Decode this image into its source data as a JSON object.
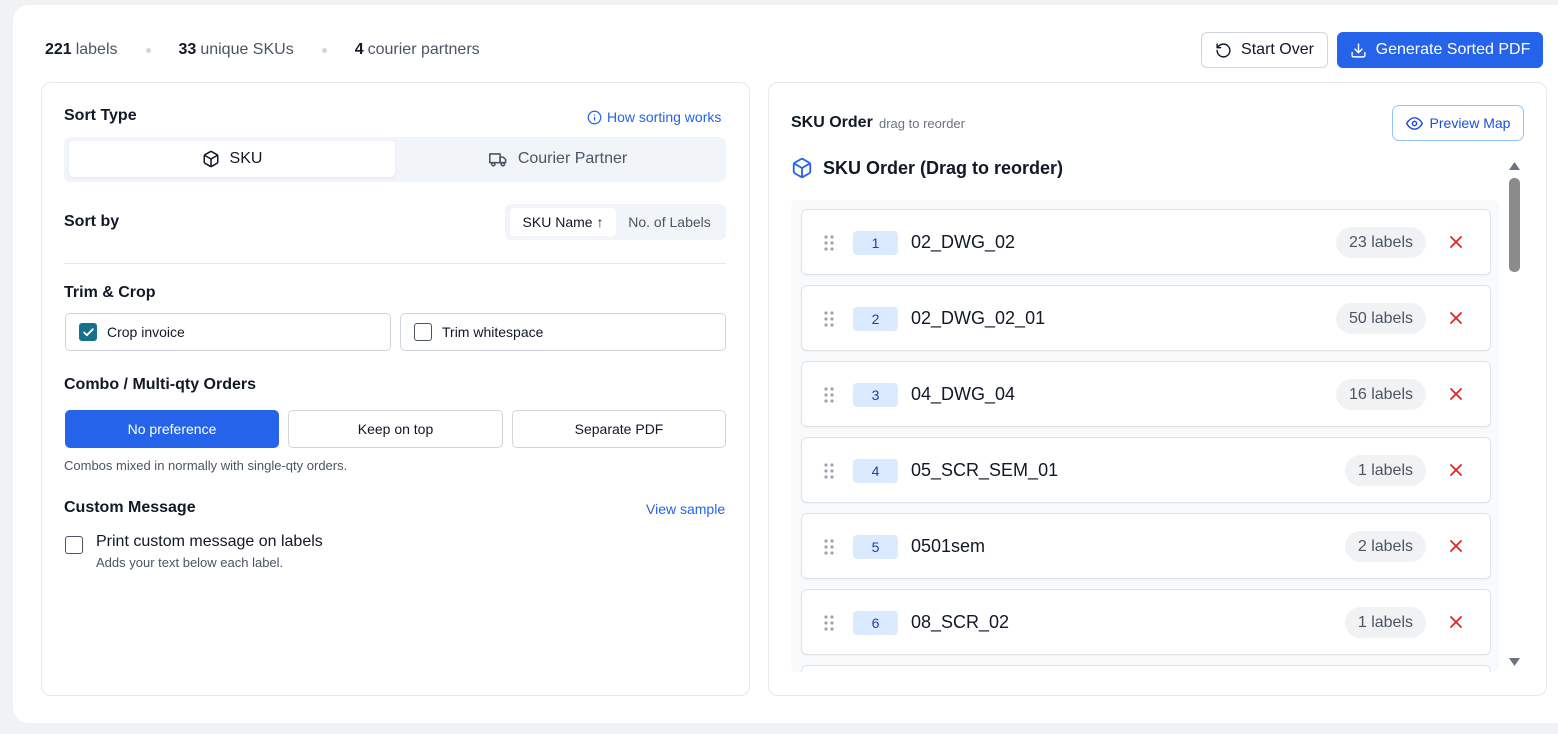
{
  "stats": {
    "labels_count": "221",
    "labels_word": "labels",
    "skus_count": "33",
    "skus_word": "unique SKUs",
    "couriers_count": "4",
    "couriers_word": "courier partners"
  },
  "header": {
    "start_over_label": "Start Over",
    "generate_label": "Generate Sorted PDF"
  },
  "left": {
    "sort_type_heading": "Sort Type",
    "how_sorting_link": "How sorting works",
    "sort_type_options": [
      {
        "label": "SKU",
        "icon": "box-icon",
        "active": true
      },
      {
        "label": "Courier Partner",
        "icon": "truck-icon",
        "active": false
      }
    ],
    "sort_by_heading": "Sort by",
    "sort_by_options": [
      {
        "label": "SKU Name ↑",
        "active": true
      },
      {
        "label": "No. of Labels",
        "active": false
      }
    ],
    "trim_heading": "Trim & Crop",
    "crop_invoice_label": "Crop invoice",
    "crop_invoice_checked": true,
    "trim_whitespace_label": "Trim whitespace",
    "trim_whitespace_checked": false,
    "combo_heading": "Combo / Multi-qty Orders",
    "combo_options": [
      {
        "label": "No preference",
        "active": true
      },
      {
        "label": "Keep on top",
        "active": false
      },
      {
        "label": "Separate PDF",
        "active": false
      }
    ],
    "combo_help": "Combos mixed in normally with single-qty orders.",
    "custom_heading": "Custom Message",
    "view_sample_link": "View sample",
    "custom_checkbox_label": "Print custom message on labels",
    "custom_checkbox_help": "Adds your text below each label.",
    "custom_checked": false
  },
  "right": {
    "title": "SKU Order",
    "subtitle": "drag to reorder",
    "preview_label": "Preview Map",
    "list_title": "SKU Order (Drag to reorder)",
    "items": [
      {
        "index": "1",
        "sku": "02_DWG_02",
        "count": "23 labels"
      },
      {
        "index": "2",
        "sku": "02_DWG_02_01",
        "count": "50 labels"
      },
      {
        "index": "3",
        "sku": "04_DWG_04",
        "count": "16 labels"
      },
      {
        "index": "4",
        "sku": "05_SCR_SEM_01",
        "count": "1 labels"
      },
      {
        "index": "5",
        "sku": "0501sem",
        "count": "2 labels"
      },
      {
        "index": "6",
        "sku": "08_SCR_02",
        "count": "1 labels"
      }
    ]
  },
  "colors": {
    "accent": "#2563eb",
    "checkbox_on": "#16718a",
    "delete": "#dc2626"
  }
}
